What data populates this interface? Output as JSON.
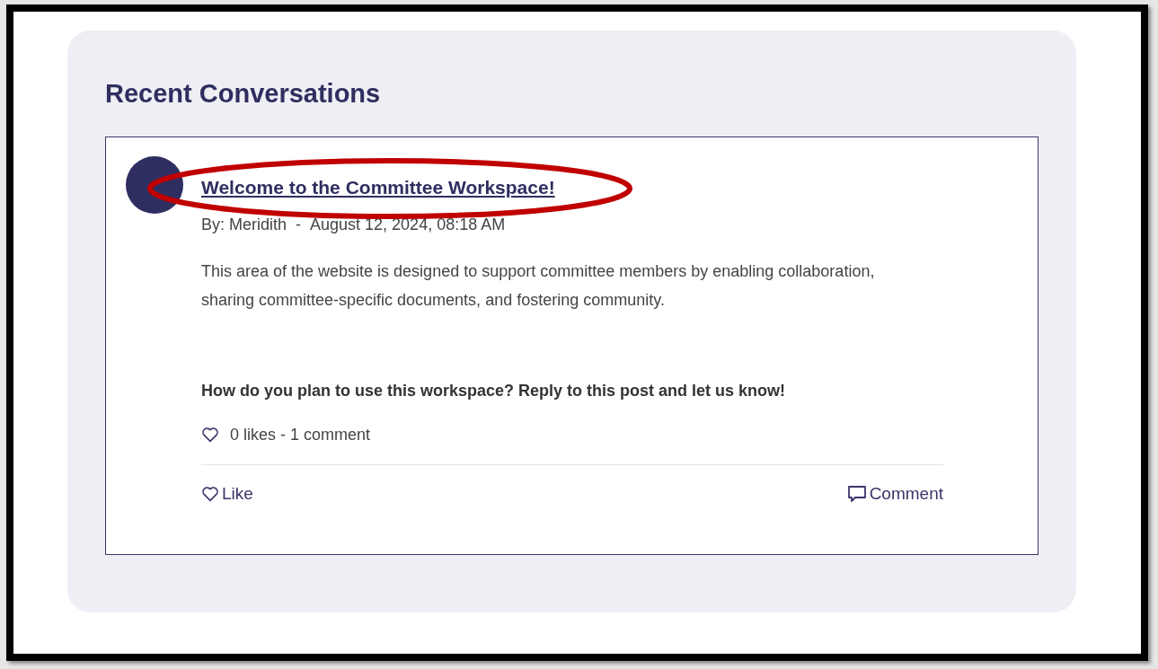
{
  "section": {
    "title": "Recent Conversations"
  },
  "posts": [
    {
      "title": "Welcome to the Committee Workspace!",
      "author": "By: Meridith",
      "separator": "-",
      "date": "August 12, 2024, 08:18 AM",
      "body": "This area of the website is designed to support committee members by enabling collaboration, sharing committee-specific documents, and fostering community.",
      "question": "How do you plan to use this workspace? Reply to this post and let us know!",
      "stats": "0 likes - 1 comment",
      "liked": false,
      "actions": [
        {
          "kind": "like",
          "label": "Like"
        },
        {
          "kind": "comment",
          "label": "Comment"
        }
      ]
    }
  ]
}
